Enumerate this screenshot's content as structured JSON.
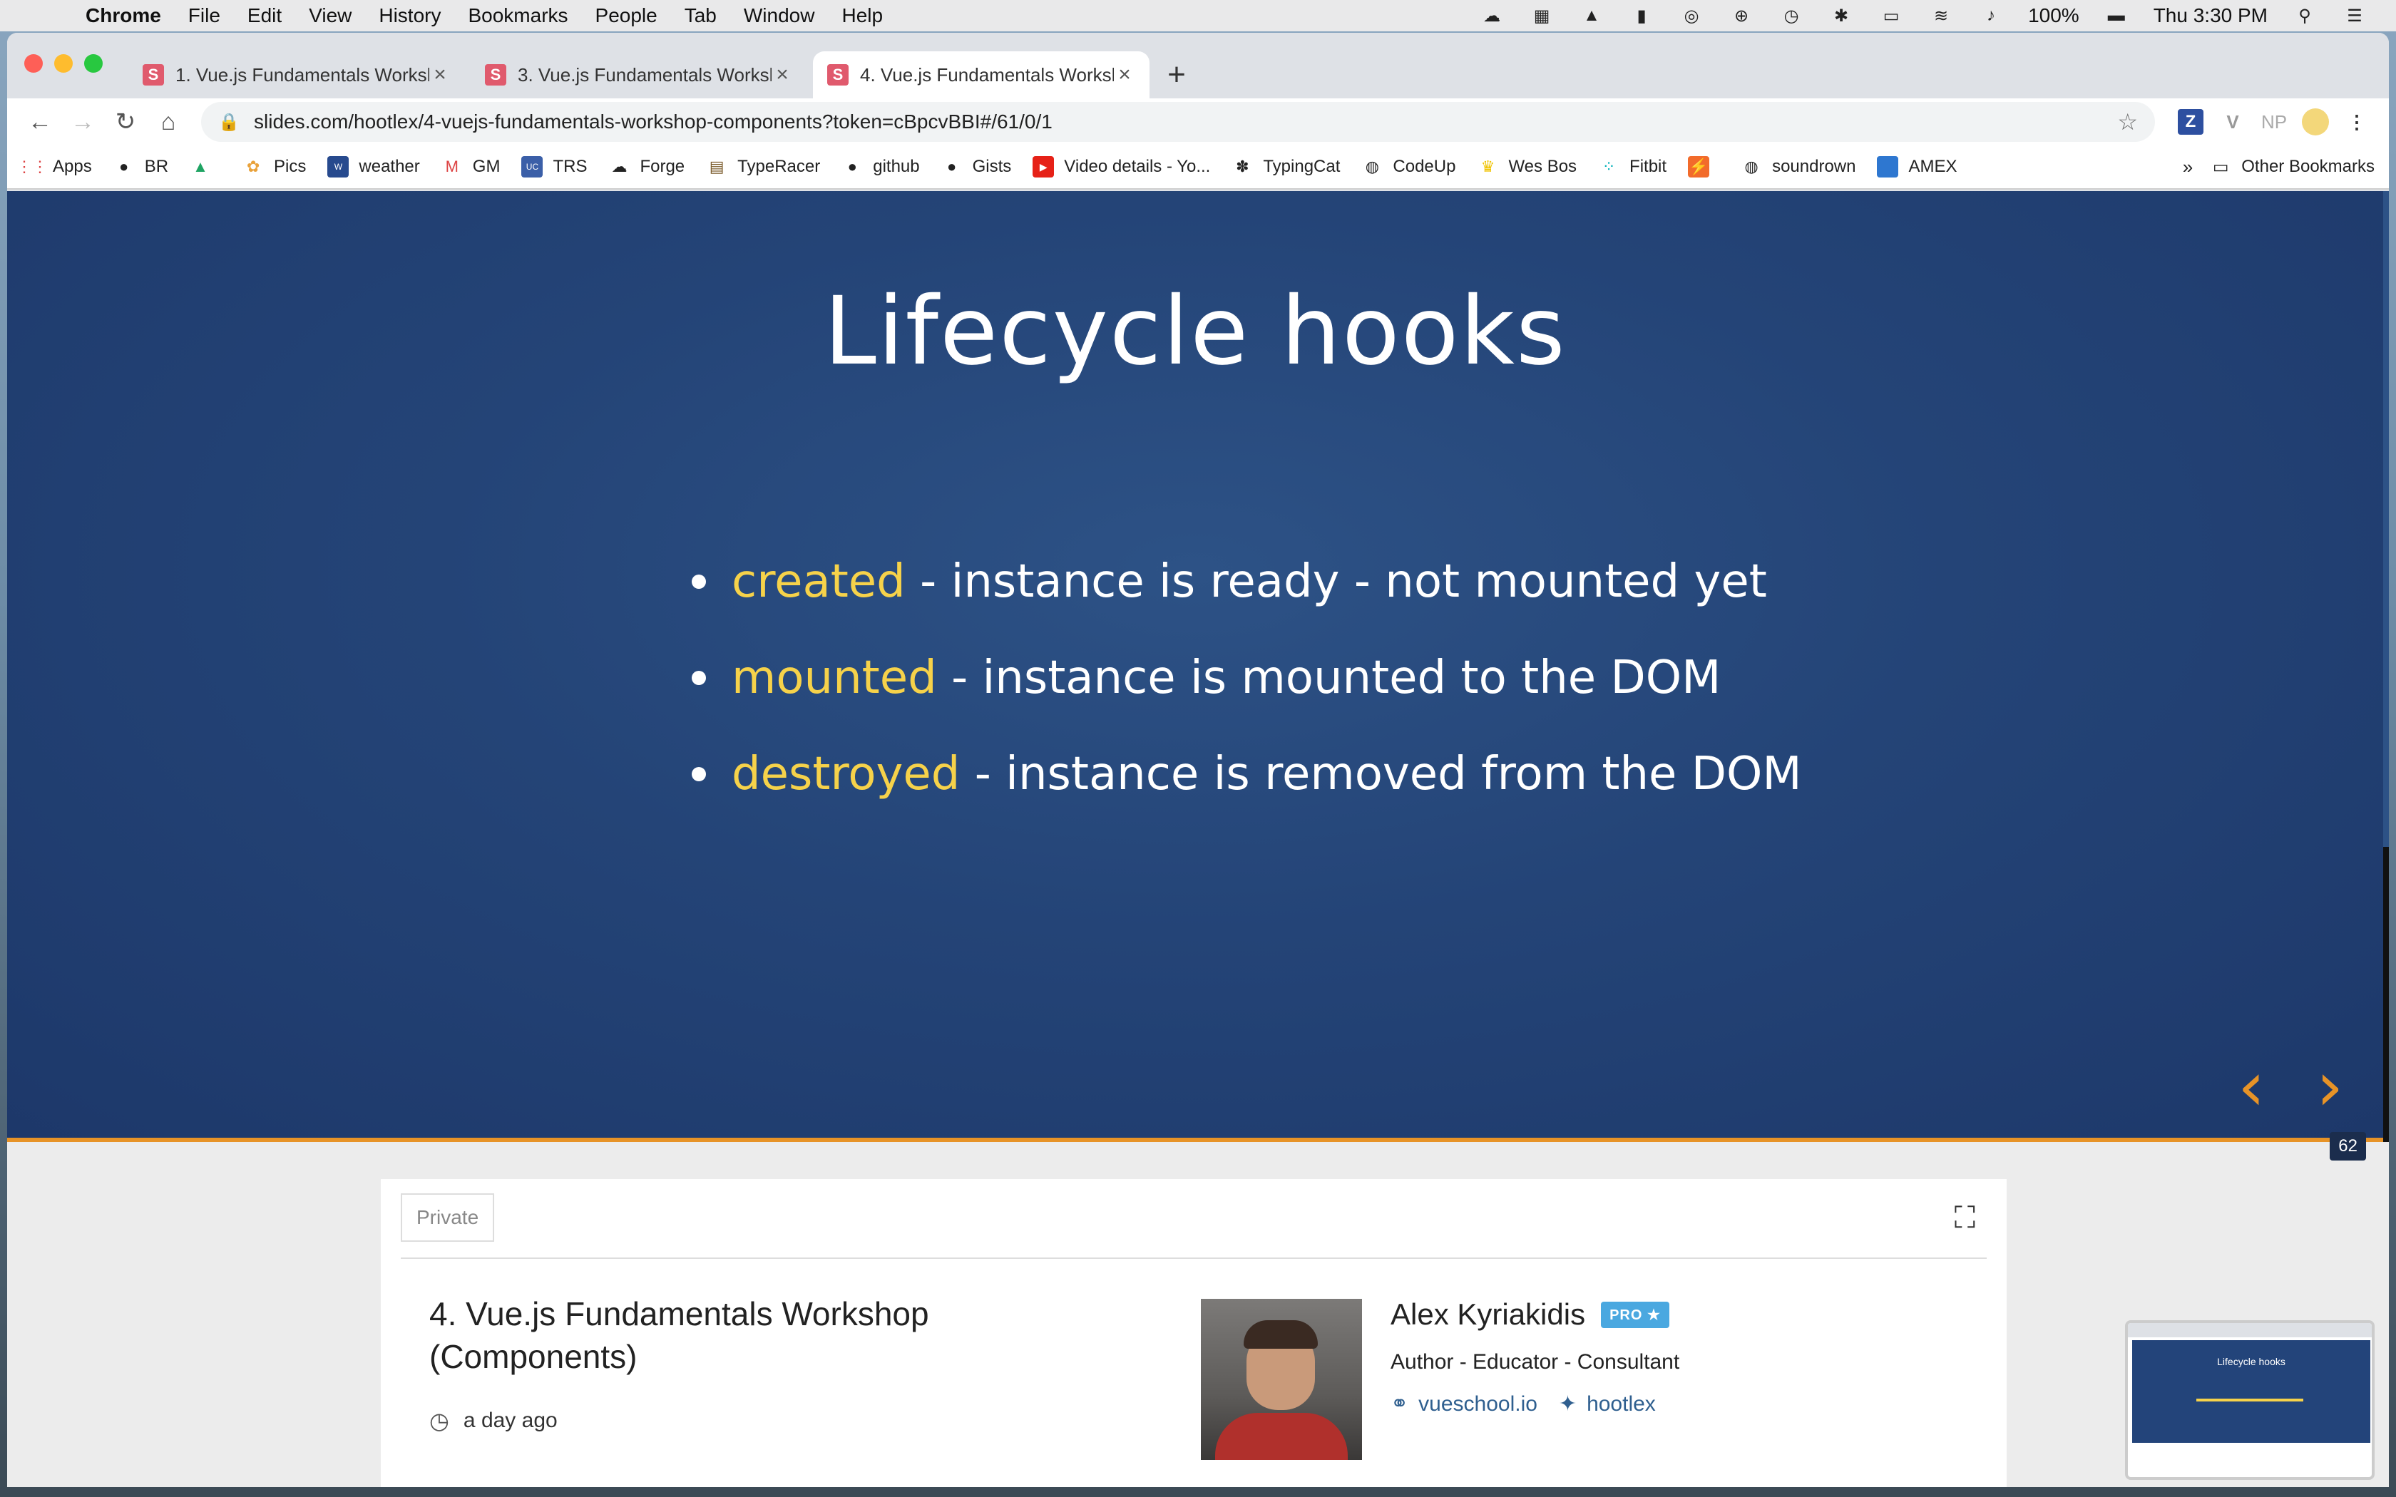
{
  "menubar": {
    "app": "Chrome",
    "items": [
      "File",
      "Edit",
      "View",
      "History",
      "Bookmarks",
      "People",
      "Tab",
      "Window",
      "Help"
    ],
    "battery": "100%",
    "clock": "Thu 3:30 PM"
  },
  "browser": {
    "tabs": [
      {
        "title": "1. Vue.js Fundamentals Worksh",
        "favicon": "S"
      },
      {
        "title": "3. Vue.js Fundamentals Worksh",
        "favicon": "S"
      },
      {
        "title": "4. Vue.js Fundamentals Worksh",
        "favicon": "S",
        "active": true
      }
    ],
    "url": "slides.com/hootlex/4-vuejs-fundamentals-workshop-components?token=cBpcvBBI#/61/0/1",
    "extensions": [
      "Z",
      "V",
      "NP"
    ],
    "bookmarks": [
      {
        "label": "Apps",
        "icon": "apps-grid-icon"
      },
      {
        "label": "BR",
        "icon": "github-icon"
      },
      {
        "label": "",
        "icon": "drive-icon"
      },
      {
        "label": "Pics",
        "icon": "photos-icon"
      },
      {
        "label": "weather",
        "icon": "weather-icon"
      },
      {
        "label": "GM",
        "icon": "gmail-icon"
      },
      {
        "label": "TRS",
        "icon": "trs-icon"
      },
      {
        "label": "Forge",
        "icon": "forge-icon"
      },
      {
        "label": "TypeRacer",
        "icon": "typeracer-icon"
      },
      {
        "label": "github",
        "icon": "github-icon"
      },
      {
        "label": "Gists",
        "icon": "github-icon"
      },
      {
        "label": "Video details - Yo...",
        "icon": "youtube-icon"
      },
      {
        "label": "TypingCat",
        "icon": "paw-icon"
      },
      {
        "label": "CodeUp",
        "icon": "globe-icon"
      },
      {
        "label": "Wes Bos",
        "icon": "crown-icon"
      },
      {
        "label": "Fitbit",
        "icon": "fitbit-icon"
      },
      {
        "label": "",
        "icon": "orange-icon"
      },
      {
        "label": "soundrown",
        "icon": "globe-icon"
      },
      {
        "label": "AMEX",
        "icon": "amex-icon"
      }
    ],
    "bookmarks_more": "»",
    "other_bookmarks": "Other Bookmarks"
  },
  "slide": {
    "title": "Lifecycle hooks",
    "bullets": [
      {
        "keyword": "created",
        "text": " - instance is ready - not mounted yet"
      },
      {
        "keyword": "mounted",
        "text": " - instance is mounted to the DOM"
      },
      {
        "keyword": "destroyed",
        "text": " - instance is removed from the DOM"
      }
    ],
    "slide_number": "62",
    "prev_label": "‹",
    "next_label": "›",
    "colors": {
      "background": "#244477",
      "keyword": "#f6d24a",
      "accent": "#e79327"
    }
  },
  "deck": {
    "privacy": "Private",
    "title": "4. Vue.js Fundamentals Workshop (Components)",
    "updated": "a day ago",
    "author": {
      "name": "Alex Kyriakidis",
      "badge": "PRO ★",
      "role": "Author - Educator - Consultant",
      "website": "vueschool.io",
      "twitter": "hootlex"
    }
  },
  "pip": {
    "title": "Lifecycle hooks"
  }
}
